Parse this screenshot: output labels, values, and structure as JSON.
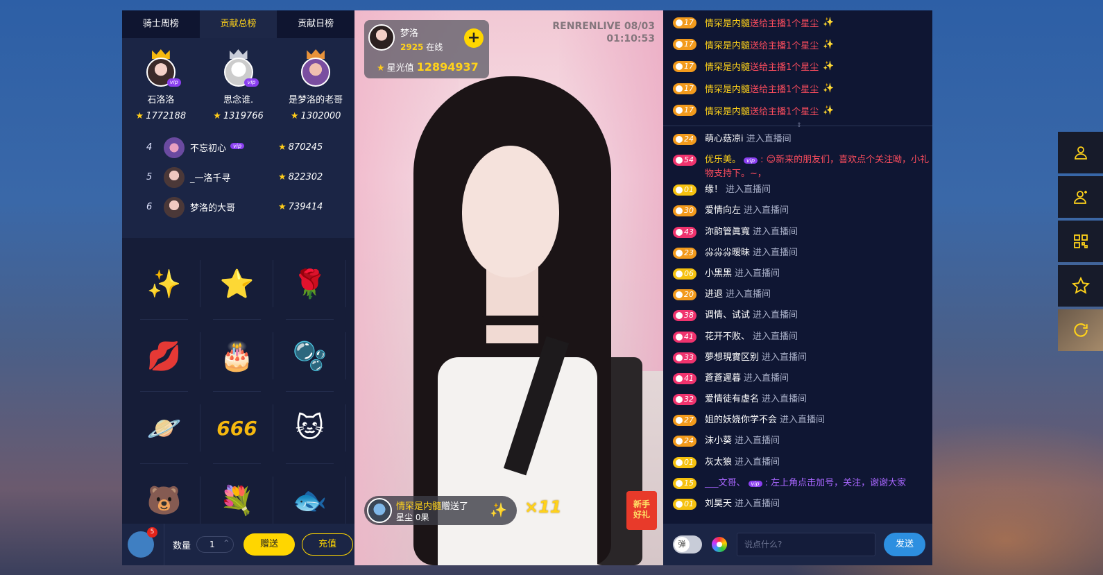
{
  "tabs": [
    "骑士周榜",
    "贡献总榜",
    "贡献日榜"
  ],
  "active_tab": 1,
  "podium": [
    {
      "name": "石洛洛",
      "score": "1772188",
      "crown_color": "#f5b80f",
      "vip": "vip"
    },
    {
      "name": "思念谁.",
      "score": "1319766",
      "crown_color": "#c8ccd8",
      "vip": "vip"
    },
    {
      "name": "是梦洛的老哥",
      "score": "1302000",
      "crown_color": "#e8923a",
      "vip": ""
    }
  ],
  "ranks": [
    {
      "rank": "4",
      "name": "不忘初心",
      "vip": "vip",
      "score": "870245"
    },
    {
      "rank": "5",
      "name": "_一洛千寻",
      "vip": "",
      "score": "822302"
    },
    {
      "rank": "6",
      "name": "梦洛的大哥",
      "vip": "",
      "score": "739414"
    }
  ],
  "gifts": [
    "✨",
    "⭐",
    "🌹",
    "💋",
    "🎂",
    "🫧",
    "🪐",
    "666",
    "🐱",
    "🐻",
    "💐",
    "🐟"
  ],
  "bottom": {
    "badge": "5",
    "qty_label": "数量",
    "qty_value": "1",
    "send": "赠送",
    "charge": "充值"
  },
  "video": {
    "watermark_line1": "RENRENLIVE 08/03",
    "watermark_line2": "01:10:53",
    "anchor_name": "梦洛",
    "online_count": "2925",
    "online_label": "在线",
    "follow_icon": "+",
    "star_label": "星光值",
    "star_value": "12894937",
    "toast_user": "情罙是内髓",
    "toast_action": "赠送了",
    "toast_gift": "星尘 0果",
    "toast_icon": "✨",
    "combo": "×11",
    "redpack_l1": "新手",
    "redpack_l2": "好礼"
  },
  "gift_feed": [
    {
      "level": "17",
      "user": "情罙是内髓",
      "text": "送给主播1个星尘"
    },
    {
      "level": "17",
      "user": "情罙是内髓",
      "text": "送给主播1个星尘"
    },
    {
      "level": "17",
      "user": "情罙是内髓",
      "text": "送给主播1个星尘"
    },
    {
      "level": "17",
      "user": "情罙是内髓",
      "text": "送给主播1个星尘"
    },
    {
      "level": "17",
      "user": "情罙是内髓",
      "text": "送给主播1个星尘"
    }
  ],
  "messages": [
    {
      "level": "24",
      "cls": "o",
      "name": "萌心菇凉i",
      "text": "进入直播间"
    },
    {
      "level": "54",
      "cls": "p",
      "name": "优乐美。",
      "say": "😊新来的朋友们，喜欢点个关注呦，小礼物支持下。~，",
      "say_style": "red",
      "name_style": "yellow",
      "vip": "vip"
    },
    {
      "level": "01",
      "cls": "y",
      "name": "缘！",
      "text": "进入直播间"
    },
    {
      "level": "30",
      "cls": "o",
      "name": "爱情向左",
      "text": "进入直播间"
    },
    {
      "level": "43",
      "cls": "p",
      "name": "沵韵管眞寬",
      "text": "进入直播间"
    },
    {
      "level": "23",
      "cls": "o",
      "name": "尛尛尛暧昧",
      "text": "进入直播间"
    },
    {
      "level": "06",
      "cls": "y",
      "name": "小黑黑",
      "text": "进入直播间"
    },
    {
      "level": "20",
      "cls": "o",
      "name": "进退",
      "text": "进入直播间"
    },
    {
      "level": "38",
      "cls": "p",
      "name": "调情、试试",
      "text": "进入直播间"
    },
    {
      "level": "41",
      "cls": "p",
      "name": "花开不败、",
      "text": "进入直播间"
    },
    {
      "level": "33",
      "cls": "p",
      "name": "夢想現實区别",
      "text": "进入直播间"
    },
    {
      "level": "41",
      "cls": "p",
      "name": "蒼蒼遲暮",
      "text": "进入直播间"
    },
    {
      "level": "32",
      "cls": "p",
      "name": "爱情徒有虚名",
      "text": "进入直播间"
    },
    {
      "level": "27",
      "cls": "o",
      "name": "姐的妖娆你学不会",
      "text": "进入直播间"
    },
    {
      "level": "24",
      "cls": "o",
      "name": "沫小葵",
      "text": "进入直播间"
    },
    {
      "level": "01",
      "cls": "y",
      "name": "灰太狼",
      "text": "进入直播间"
    },
    {
      "level": "15",
      "cls": "y",
      "name": "___文哥、",
      "say": "左上角点击加号，关注，谢谢大家",
      "say_style": "purple",
      "name_style": "purple",
      "vip": "vip"
    },
    {
      "level": "01",
      "cls": "y",
      "name": "刘昊天",
      "text": "进入直播间"
    }
  ],
  "input": {
    "toggle_label": "弹",
    "placeholder": "说点什么?",
    "send": "发送"
  },
  "side_tools": [
    "user-icon",
    "user-add-icon",
    "qrcode-icon",
    "star-icon",
    "refresh-icon"
  ]
}
